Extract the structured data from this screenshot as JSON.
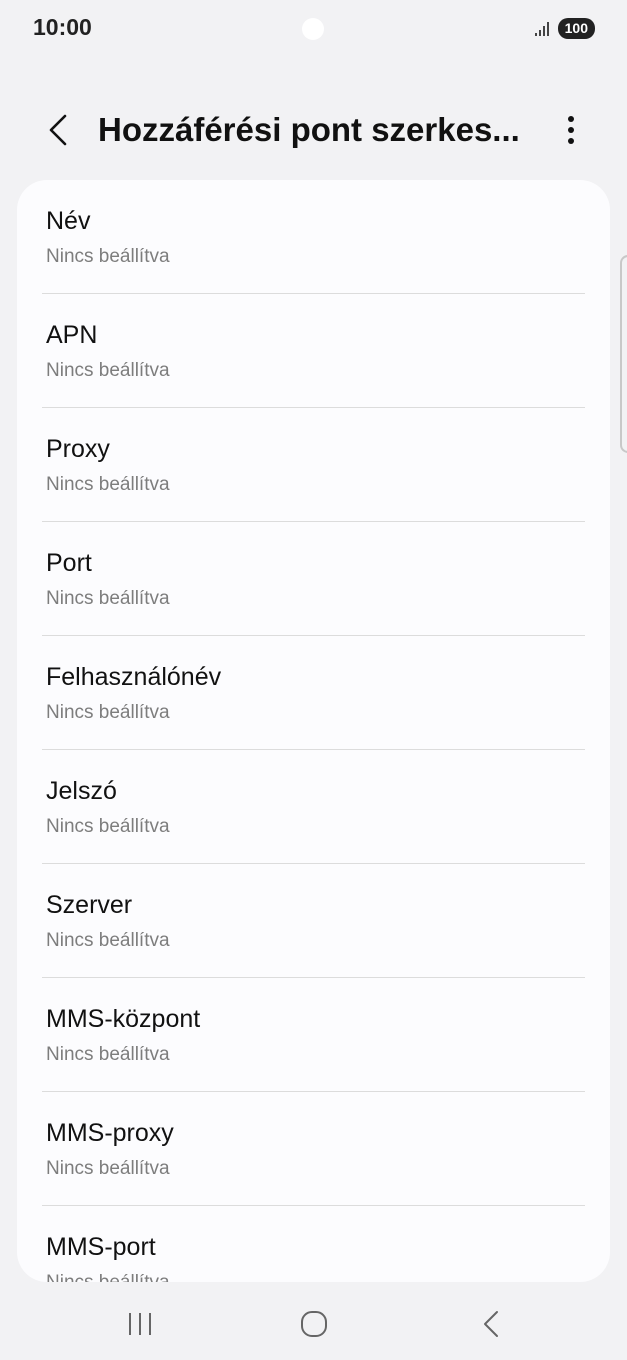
{
  "status_bar": {
    "time": "10:00",
    "battery": "100",
    "icons": [
      "signal-icon",
      "battery-icon"
    ]
  },
  "header": {
    "title": "Hozzáférési pont szerkes...",
    "back_icon": "chevron-left-icon",
    "more_icon": "more-vertical-icon"
  },
  "settings": {
    "items": [
      {
        "title": "Név",
        "value": "Nincs beállítva"
      },
      {
        "title": "APN",
        "value": "Nincs beállítva"
      },
      {
        "title": "Proxy",
        "value": "Nincs beállítva"
      },
      {
        "title": "Port",
        "value": "Nincs beállítva"
      },
      {
        "title": "Felhasználónév",
        "value": "Nincs beállítva"
      },
      {
        "title": "Jelszó",
        "value": "Nincs beállítva"
      },
      {
        "title": "Szerver",
        "value": "Nincs beállítva"
      },
      {
        "title": "MMS-központ",
        "value": "Nincs beállítva"
      },
      {
        "title": "MMS-proxy",
        "value": "Nincs beállítva"
      },
      {
        "title": "MMS-port",
        "value": "Nincs beállítva"
      }
    ]
  },
  "nav_bar": {
    "icons": [
      "recents-icon",
      "home-icon",
      "back-icon"
    ]
  },
  "colors": {
    "background": "#f2f2f4",
    "card": "#fcfcfe",
    "subtitle": "#7d7d7d",
    "divider": "#dcdcdc"
  }
}
